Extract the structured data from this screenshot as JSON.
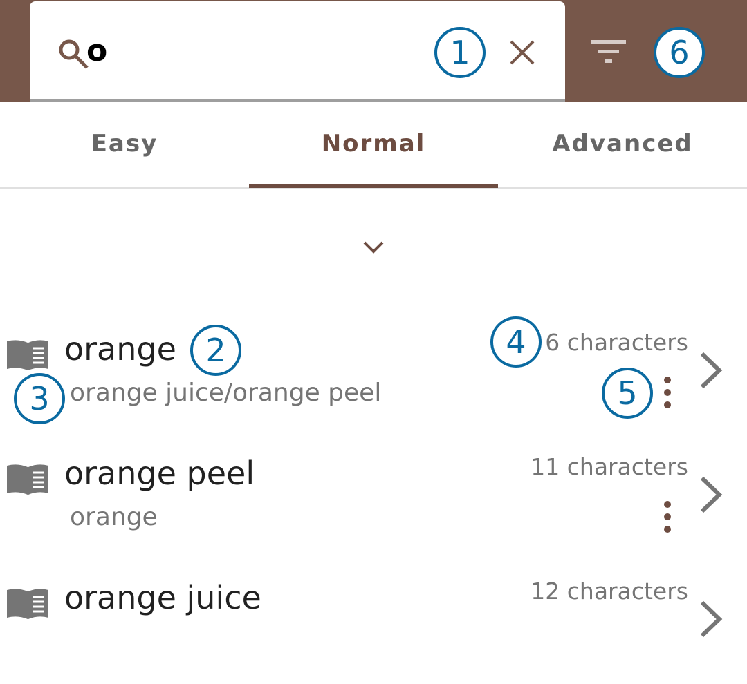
{
  "search": {
    "query": "o",
    "icon": "search-icon",
    "clear_icon": "close-icon",
    "filter_icon": "filter-icon"
  },
  "tabs": [
    {
      "label": "Easy"
    },
    {
      "label": "Normal",
      "active": true
    },
    {
      "label": "Advanced"
    }
  ],
  "expand_icon": "chevron-down-icon",
  "results": [
    {
      "title": "orange",
      "subtitle": "orange juice/orange peel",
      "count": "6 characters"
    },
    {
      "title": "orange peel",
      "subtitle": "orange",
      "count": "11 characters"
    },
    {
      "title": "orange juice",
      "subtitle": "",
      "count": "12 characters"
    }
  ],
  "callouts": [
    "1",
    "2",
    "3",
    "4",
    "5",
    "6"
  ],
  "colors": {
    "header": "#77574a",
    "accent": "#6d4c41",
    "callout": "#0a6aa1"
  }
}
